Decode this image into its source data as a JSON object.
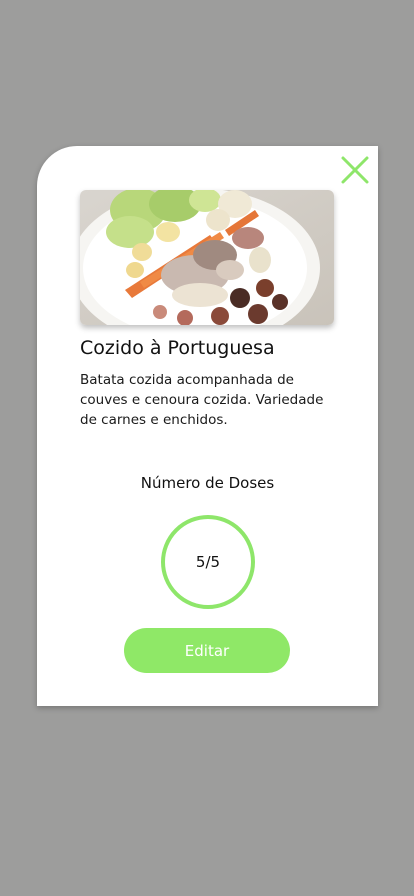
{
  "modal": {
    "close_icon": "close-icon",
    "accent_color": "#8fe867",
    "image_alt": "Cozido à Portuguesa dish photo",
    "title": "Cozido à Portuguesa",
    "description": "Batata cozida acompanhada de couves e cenoura cozida. Variedade de carnes e enchidos.",
    "doses_label": "Número de Doses",
    "doses_value": "5/5",
    "edit_label": "Editar"
  }
}
